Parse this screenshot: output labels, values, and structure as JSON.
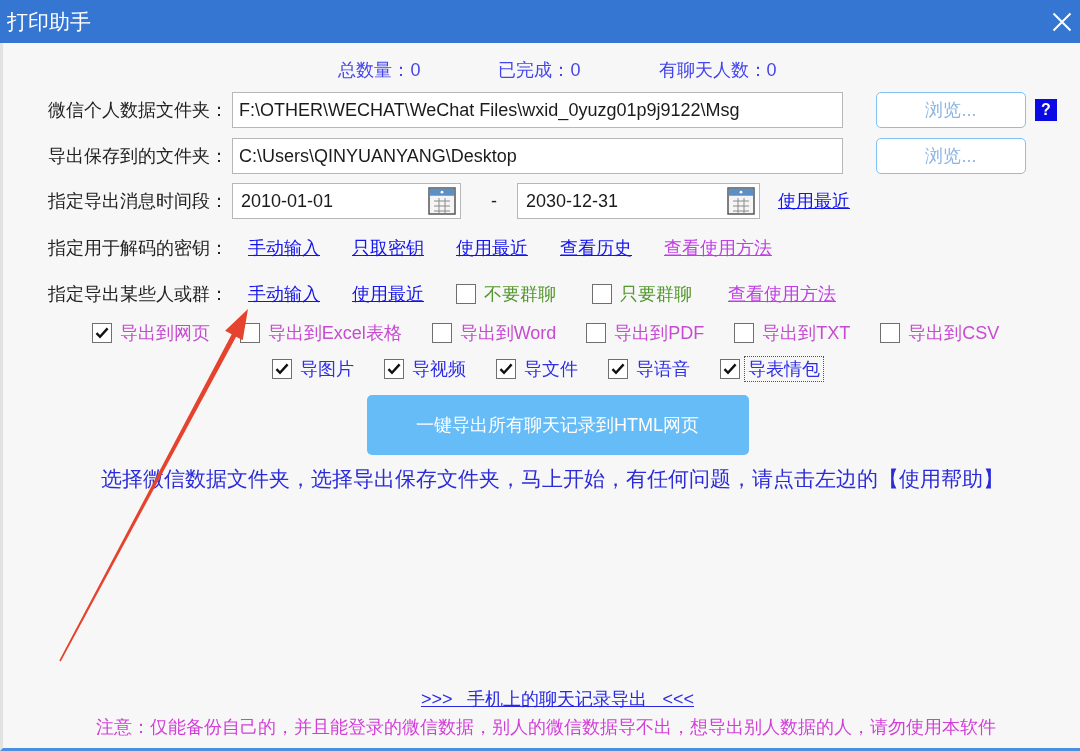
{
  "window": {
    "title": "打印助手"
  },
  "stats": [
    "总数量：0",
    "已完成：0",
    "有聊天人数：0"
  ],
  "folders": [
    {
      "label": "微信个人数据文件夹：",
      "value": "F:\\OTHER\\WECHAT\\WeChat Files\\wxid_0yuzg01p9j9122\\Msg",
      "button": "浏览...",
      "help": "?"
    },
    {
      "label": "导出保存到的文件夹：",
      "value": "C:\\Users\\QINYUANYANG\\Desktop",
      "button": "浏览..."
    }
  ],
  "date_range": {
    "label": "指定导出消息时间段：",
    "start": "2010-01-01",
    "separator": "-",
    "end": "2030-12-31",
    "link": "使用最近"
  },
  "key_row": {
    "label": "指定用于解码的密钥：",
    "links": [
      {
        "text": "手动输入",
        "color": "#1414ee"
      },
      {
        "text": "只取密钥",
        "color": "#1414ee"
      },
      {
        "text": "使用最近",
        "color": "#1414ee"
      },
      {
        "text": "查看历史",
        "color": "#1414ee"
      },
      {
        "text": "查看使用方法",
        "color": "#c03ee6"
      }
    ]
  },
  "people_row": {
    "label": "指定导出某些人或群：",
    "items": [
      {
        "kind": "link",
        "text": "手动输入",
        "color": "#1414ee"
      },
      {
        "kind": "link",
        "text": "使用最近",
        "color": "#1414ee"
      },
      {
        "kind": "checkbox",
        "text": "不要群聊",
        "checked": false
      },
      {
        "kind": "checkbox",
        "text": "只要群聊",
        "checked": false
      },
      {
        "kind": "link",
        "text": "查看使用方法",
        "color": "#c03ee6"
      }
    ]
  },
  "export_formats": [
    {
      "label": "导出到网页",
      "checked": true
    },
    {
      "label": "导出到Excel表格",
      "checked": false
    },
    {
      "label": "导出到Word",
      "checked": false
    },
    {
      "label": "导出到PDF",
      "checked": false
    },
    {
      "label": "导出到TXT",
      "checked": false
    },
    {
      "label": "导出到CSV",
      "checked": false
    }
  ],
  "media_types": [
    {
      "label": "导图片",
      "checked": true,
      "focused": false
    },
    {
      "label": "导视频",
      "checked": true,
      "focused": false
    },
    {
      "label": "导文件",
      "checked": true,
      "focused": false
    },
    {
      "label": "导语音",
      "checked": true,
      "focused": false
    },
    {
      "label": "导表情包",
      "checked": true,
      "focused": true
    }
  ],
  "export_button": "一键导出所有聊天记录到HTML网页",
  "hint": "选择微信数据文件夹，选择导出保存文件夹，马上开始，有任何问题，请点击左边的【使用帮助】",
  "mobile_link": ">>>   手机上的聊天记录导出   <<<",
  "notice": "注意：仅能备份自己的，并且能登录的微信数据，别人的微信数据导不出，想导出别人数据的人，请勿使用本软件"
}
